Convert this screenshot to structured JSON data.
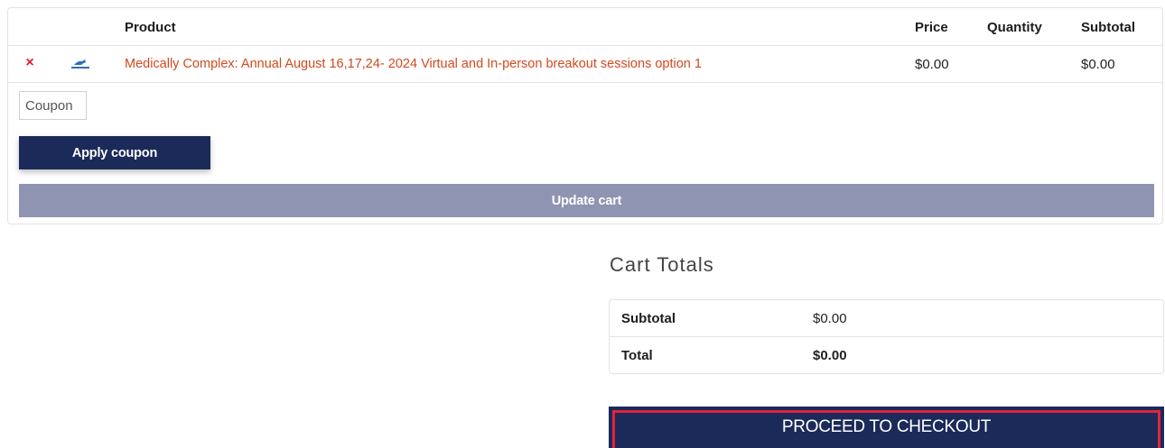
{
  "cart": {
    "columns": {
      "product": "Product",
      "price": "Price",
      "quantity": "Quantity",
      "subtotal": "Subtotal"
    },
    "items": [
      {
        "remove_icon": "×",
        "thumbnail_icon": "product-thumbnail-icon",
        "product_name": "Medically Complex: Annual August 16,17,24- 2024 Virtual and In-person breakout sessions option 1",
        "price": "$0.00",
        "quantity": "",
        "subtotal": "$0.00"
      }
    ],
    "coupon_placeholder": "Coupon",
    "apply_coupon_label": "Apply coupon",
    "update_cart_label": "Update cart"
  },
  "totals": {
    "title": "Cart Totals",
    "subtotal_label": "Subtotal",
    "subtotal_value": "$0.00",
    "total_label": "Total",
    "total_value": "$0.00",
    "checkout_label": "PROCEED TO CHECKOUT"
  },
  "colors": {
    "primary": "#1c2a5a",
    "update_button": "#8e94b1",
    "link": "#d2491f",
    "remove": "#e0202a",
    "highlight_outline": "#e0243a"
  }
}
